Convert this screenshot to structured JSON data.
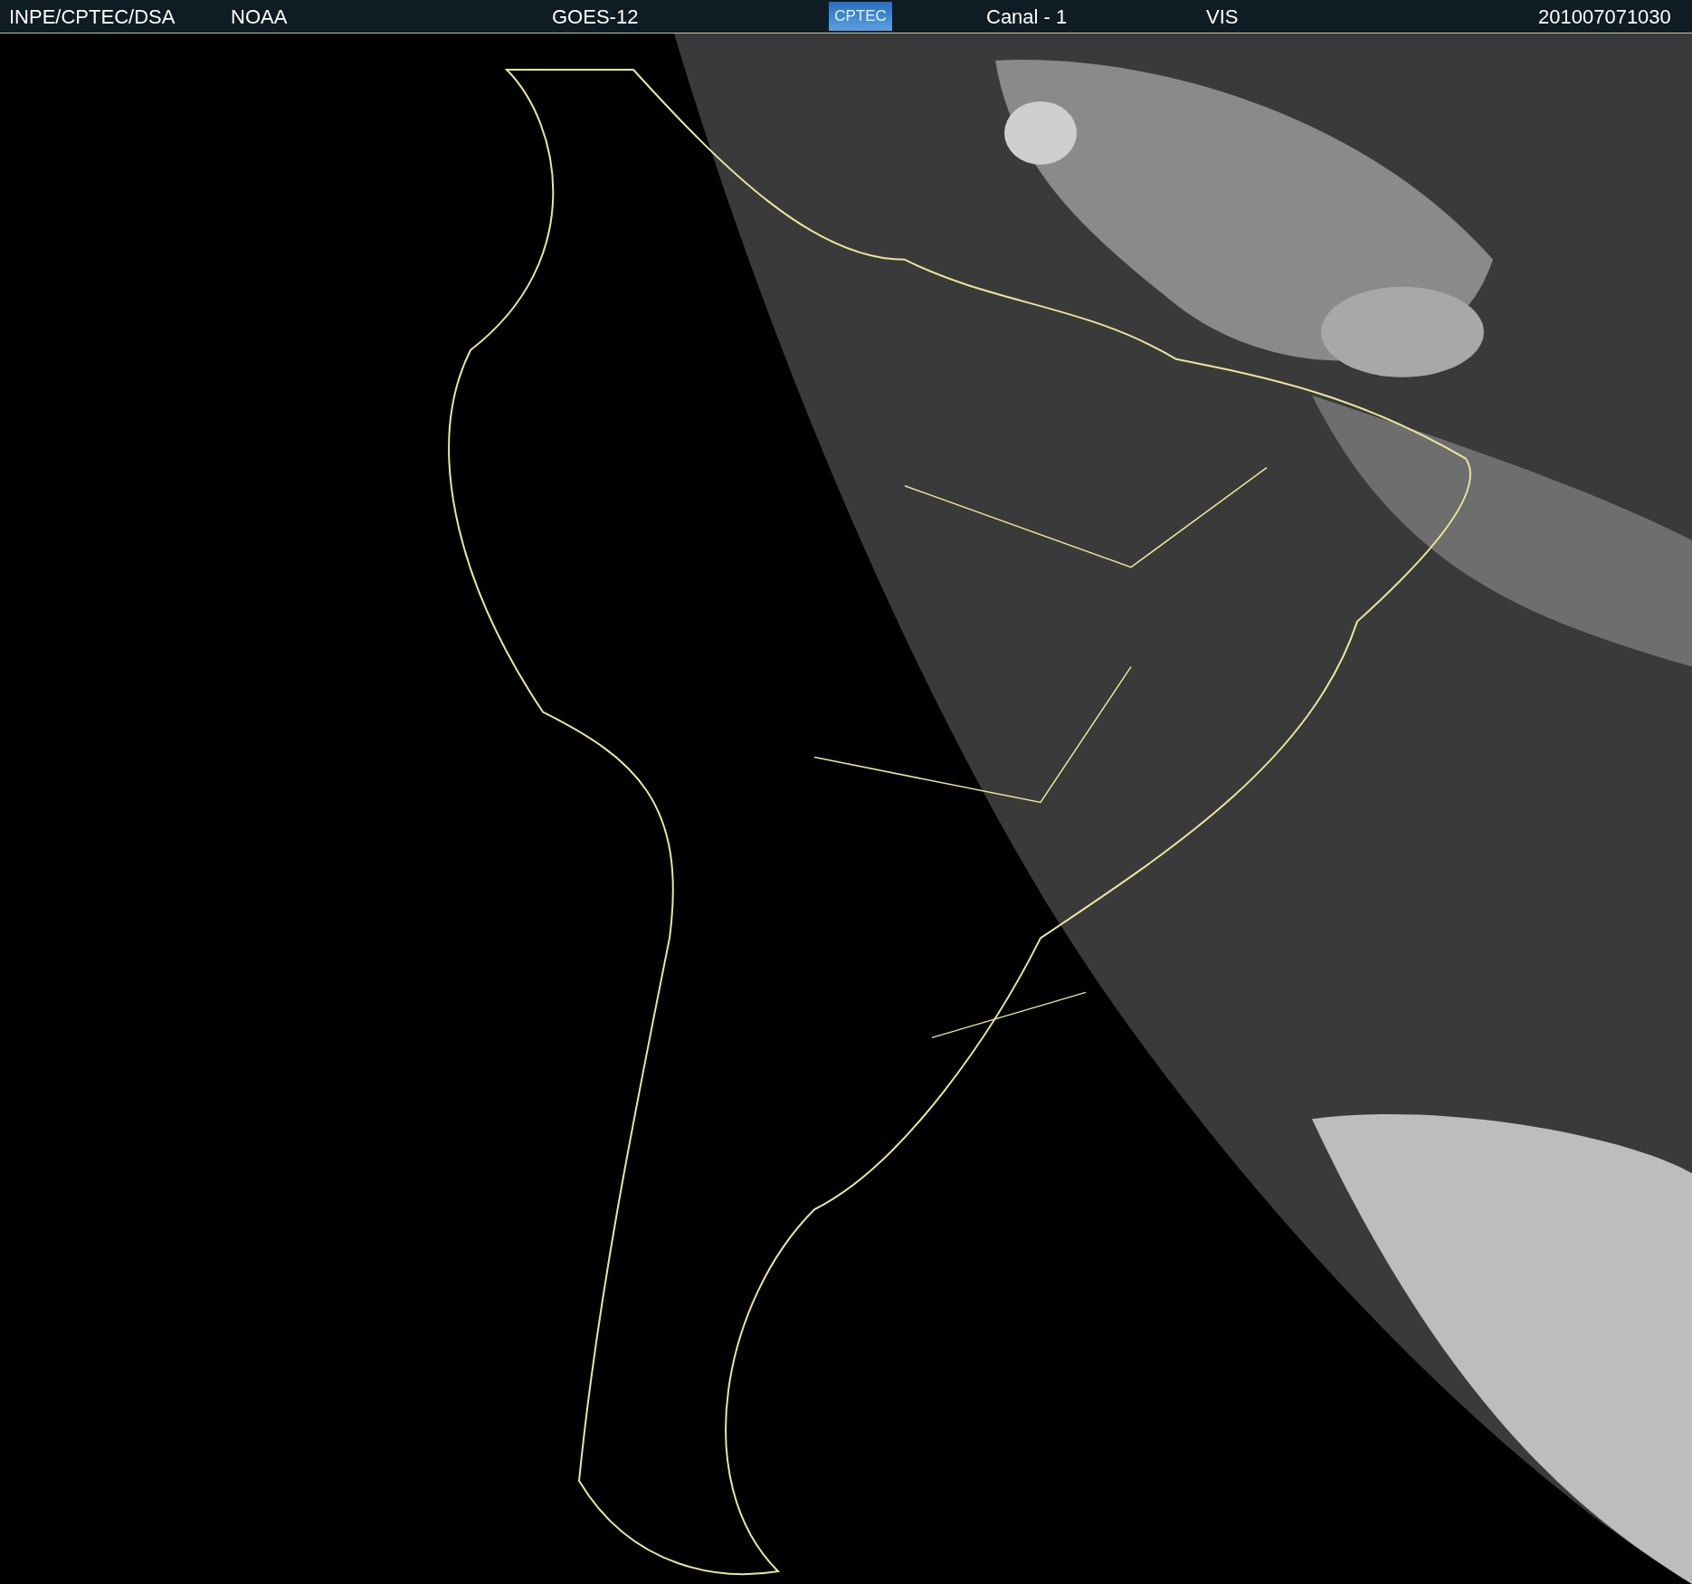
{
  "header": {
    "items": [
      {
        "kind": "text",
        "text": "INPE/CPTEC/DSA"
      },
      {
        "kind": "text",
        "text": "NOAA"
      },
      {
        "kind": "text",
        "text": "GOES-12"
      },
      {
        "kind": "logo",
        "text": "CPTEC"
      },
      {
        "kind": "text",
        "text": "Canal - 1"
      },
      {
        "kind": "text",
        "text": "VIS"
      },
      {
        "kind": "text",
        "text": "201007071030"
      }
    ]
  }
}
